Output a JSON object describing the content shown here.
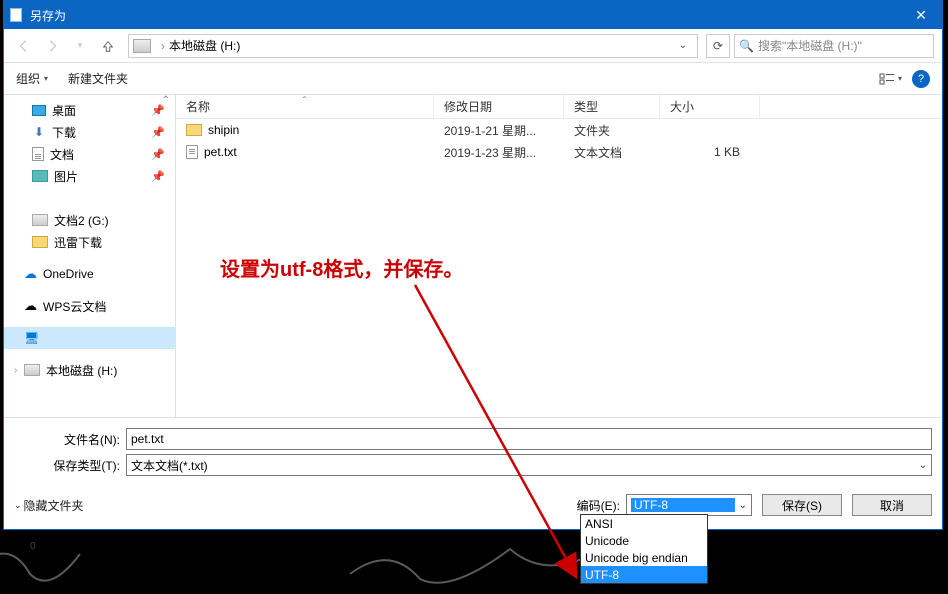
{
  "window": {
    "title": "另存为"
  },
  "address": {
    "drive_sep": "›",
    "location": "本地磁盘 (H:)"
  },
  "search": {
    "placeholder": "搜索\"本地磁盘 (H:)\""
  },
  "toolbar": {
    "organize": "组织",
    "new_folder": "新建文件夹"
  },
  "columns": {
    "name": "名称",
    "date": "修改日期",
    "type": "类型",
    "size": "大小"
  },
  "sidebar": {
    "quick": [
      {
        "label": "桌面",
        "kind": "desktop",
        "pinned": true
      },
      {
        "label": "下载",
        "kind": "download",
        "pinned": true
      },
      {
        "label": "文档",
        "kind": "doc",
        "pinned": true
      },
      {
        "label": "图片",
        "kind": "pic",
        "pinned": true
      },
      {
        "label": "",
        "kind": "blank",
        "pinned": false
      },
      {
        "label": "文档2 (G:)",
        "kind": "drive",
        "pinned": false
      },
      {
        "label": "迅雷下载",
        "kind": "folder",
        "pinned": false
      }
    ],
    "onedrive": "OneDrive",
    "wps": "WPS云文档",
    "thispc_children": [
      {
        "label": "本地磁盘 (H:)",
        "kind": "drive"
      }
    ]
  },
  "files": [
    {
      "name": "shipin",
      "date": "2019-1-21 星期...",
      "type": "文件夹",
      "size": "",
      "icon": "folder"
    },
    {
      "name": "pet.txt",
      "date": "2019-1-23 星期...",
      "type": "文本文档",
      "size": "1 KB",
      "icon": "txt"
    }
  ],
  "form": {
    "filename_label": "文件名(N):",
    "filename_value": "pet.txt",
    "type_label": "保存类型(T):",
    "type_value": "文本文档(*.txt)"
  },
  "footer": {
    "hide_folders": "隐藏文件夹",
    "encoding_label": "编码(E):",
    "encoding_selected": "UTF-8",
    "save": "保存(S)",
    "cancel": "取消"
  },
  "encoding_options": [
    "ANSI",
    "Unicode",
    "Unicode big endian",
    "UTF-8"
  ],
  "annotation": "设置为utf-8格式，并保存。"
}
